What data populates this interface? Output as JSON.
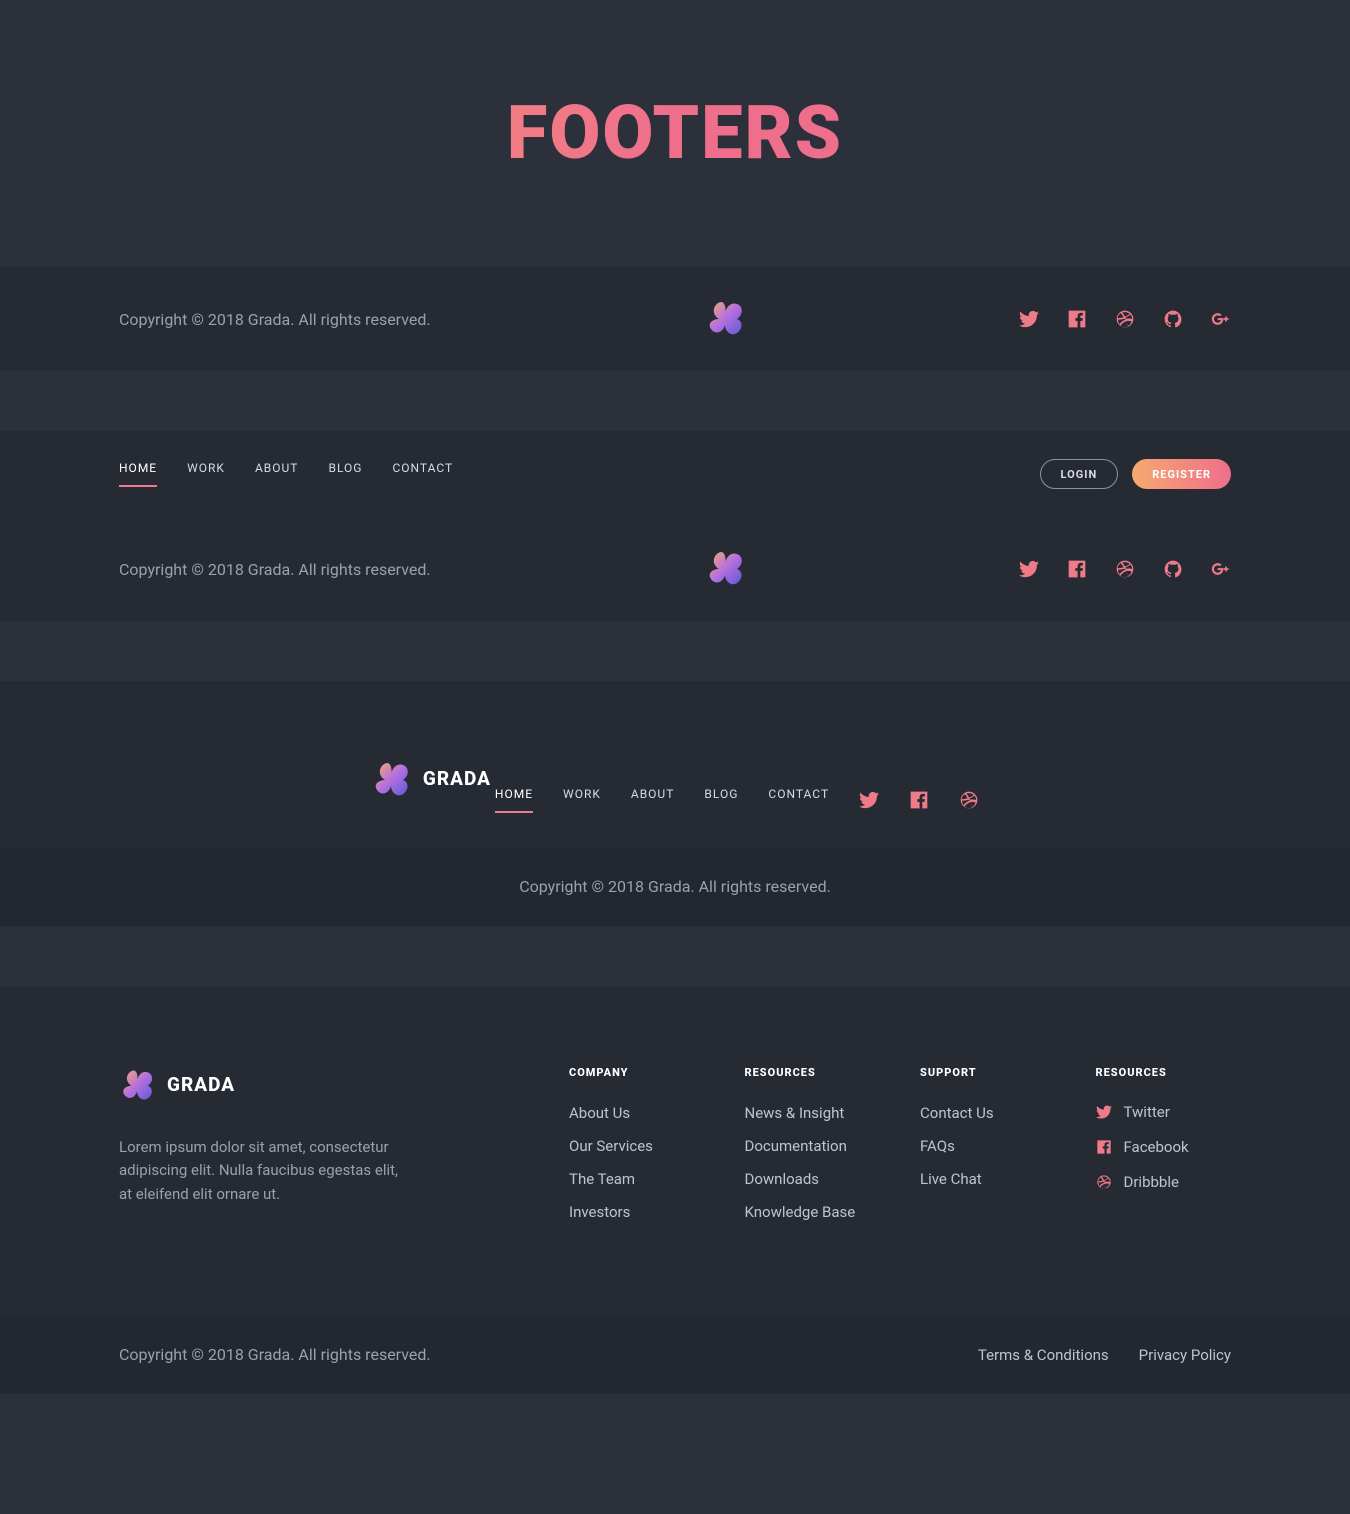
{
  "page": {
    "title": "FOOTERS"
  },
  "brand": {
    "name": "GRADA"
  },
  "copyright": "Copyright © 2018 Grada. All rights reserved.",
  "nav": {
    "items": [
      {
        "label": "HOME",
        "active": true
      },
      {
        "label": "WORK"
      },
      {
        "label": "ABOUT"
      },
      {
        "label": "BLOG"
      },
      {
        "label": "CONTACT"
      }
    ]
  },
  "auth": {
    "login": "LOGIN",
    "register": "REGISTER"
  },
  "social_full": [
    "twitter",
    "facebook",
    "dribbble",
    "github",
    "googleplus"
  ],
  "social_short": [
    "twitter",
    "facebook",
    "dribbble"
  ],
  "f4": {
    "intro": "Lorem ipsum dolor sit amet, consectetur adipiscing elit. Nulla faucibus egestas elit, at eleifend elit ornare ut.",
    "cols": [
      {
        "title": "COMPANY",
        "links": [
          "About Us",
          "Our Services",
          "The Team",
          "Investors"
        ]
      },
      {
        "title": "RESOURCES",
        "links": [
          "News & Insight",
          "Documentation",
          "Downloads",
          "Knowledge Base"
        ]
      },
      {
        "title": "SUPPORT",
        "links": [
          "Contact Us",
          "FAQs",
          "Live Chat"
        ]
      }
    ],
    "social_col": {
      "title": "RESOURCES",
      "items": [
        {
          "icon": "twitter",
          "label": "Twitter"
        },
        {
          "icon": "facebook",
          "label": "Facebook"
        },
        {
          "icon": "dribbble",
          "label": "Dribbble"
        }
      ]
    },
    "legal": [
      "Terms & Conditions",
      "Privacy Policy"
    ]
  }
}
